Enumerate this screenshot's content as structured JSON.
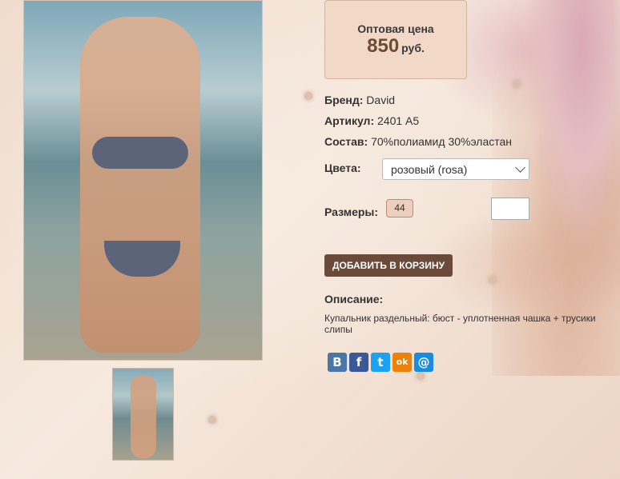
{
  "price": {
    "label": "Оптовая цена",
    "value": "850",
    "currency": "руб."
  },
  "details": {
    "brand_label": "Бренд:",
    "brand_value": "David",
    "article_label": "Артикул:",
    "article_value": "2401 A5",
    "composition_label": "Состав:",
    "composition_value": "70%полиамид 30%эластан",
    "colors_label": "Цвета:",
    "color_selected": "розовый (rosa)",
    "sizes_label": "Размеры:",
    "size_option": "44"
  },
  "cart": {
    "button_label": "ДОБАВИТЬ В КОРЗИНУ"
  },
  "description": {
    "title": "Описание:",
    "text": "Купальник раздельный: бюст - уплотненная чашка  + трусики слипы"
  },
  "share_icons": [
    {
      "name": "vk-icon",
      "glyph": "В",
      "color": "#4a76a8"
    },
    {
      "name": "facebook-icon",
      "glyph": "f",
      "color": "#3b5998"
    },
    {
      "name": "twitter-icon",
      "glyph": "t",
      "color": "#1da1f2"
    },
    {
      "name": "odnoklassniki-icon",
      "glyph": "ok",
      "color": "#ee8208"
    },
    {
      "name": "mail-icon",
      "glyph": "@",
      "color": "#168de2"
    }
  ]
}
